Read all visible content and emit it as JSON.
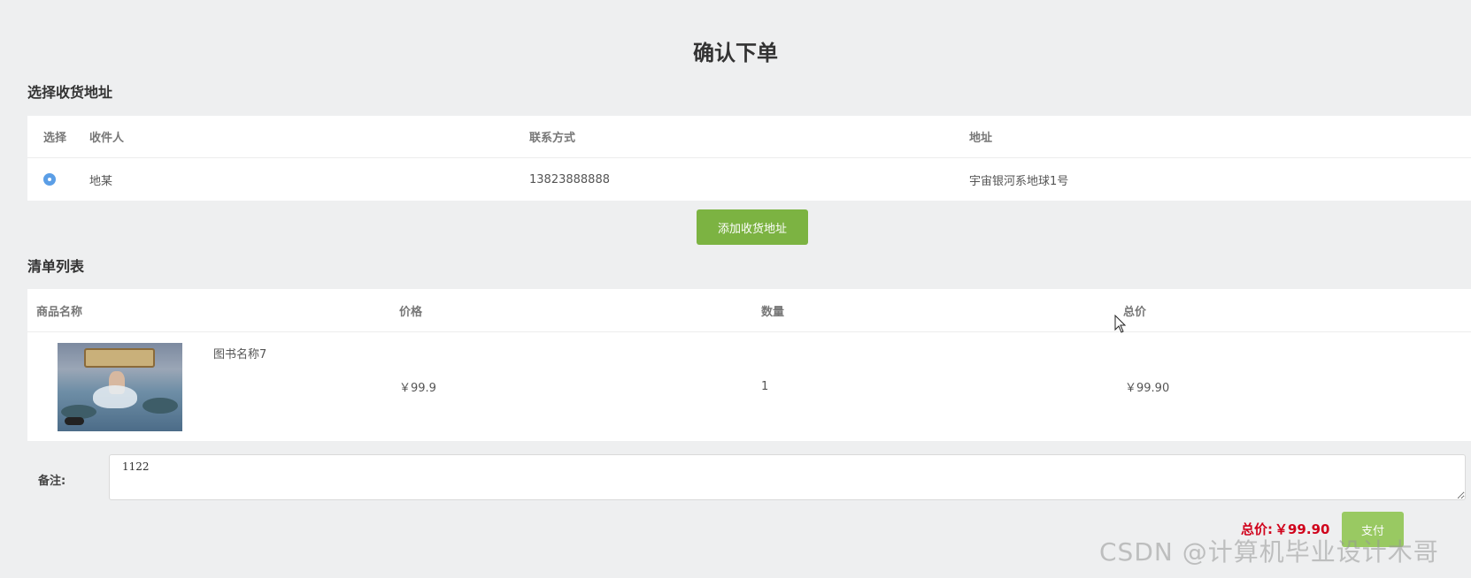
{
  "page_title": "确认下单",
  "address_section": {
    "title": "选择收货地址",
    "columns": {
      "select": "选择",
      "receiver": "收件人",
      "contact": "联系方式",
      "address": "地址"
    },
    "rows": [
      {
        "selected": true,
        "receiver": "地某",
        "contact": "13823888888",
        "address": "宇宙银河系地球1号"
      }
    ],
    "add_button_label": "添加收货地址"
  },
  "list_section": {
    "title": "清单列表",
    "columns": {
      "name": "商品名称",
      "price": "价格",
      "quantity": "数量",
      "total": "总价"
    },
    "items": [
      {
        "name": "图书名称7",
        "price": "￥99.9",
        "quantity": "1",
        "total": "￥99.90"
      }
    ]
  },
  "remark": {
    "label": "备注:",
    "value": "1122"
  },
  "summary": {
    "total_label": "总价:",
    "total_value": "￥99.90",
    "pay_button_label": "支付"
  },
  "watermark": "CSDN @计算机毕业设计木哥",
  "colors": {
    "accent_green": "#7cb342",
    "total_red": "#d0021b",
    "radio_blue": "#5b9ee6"
  }
}
